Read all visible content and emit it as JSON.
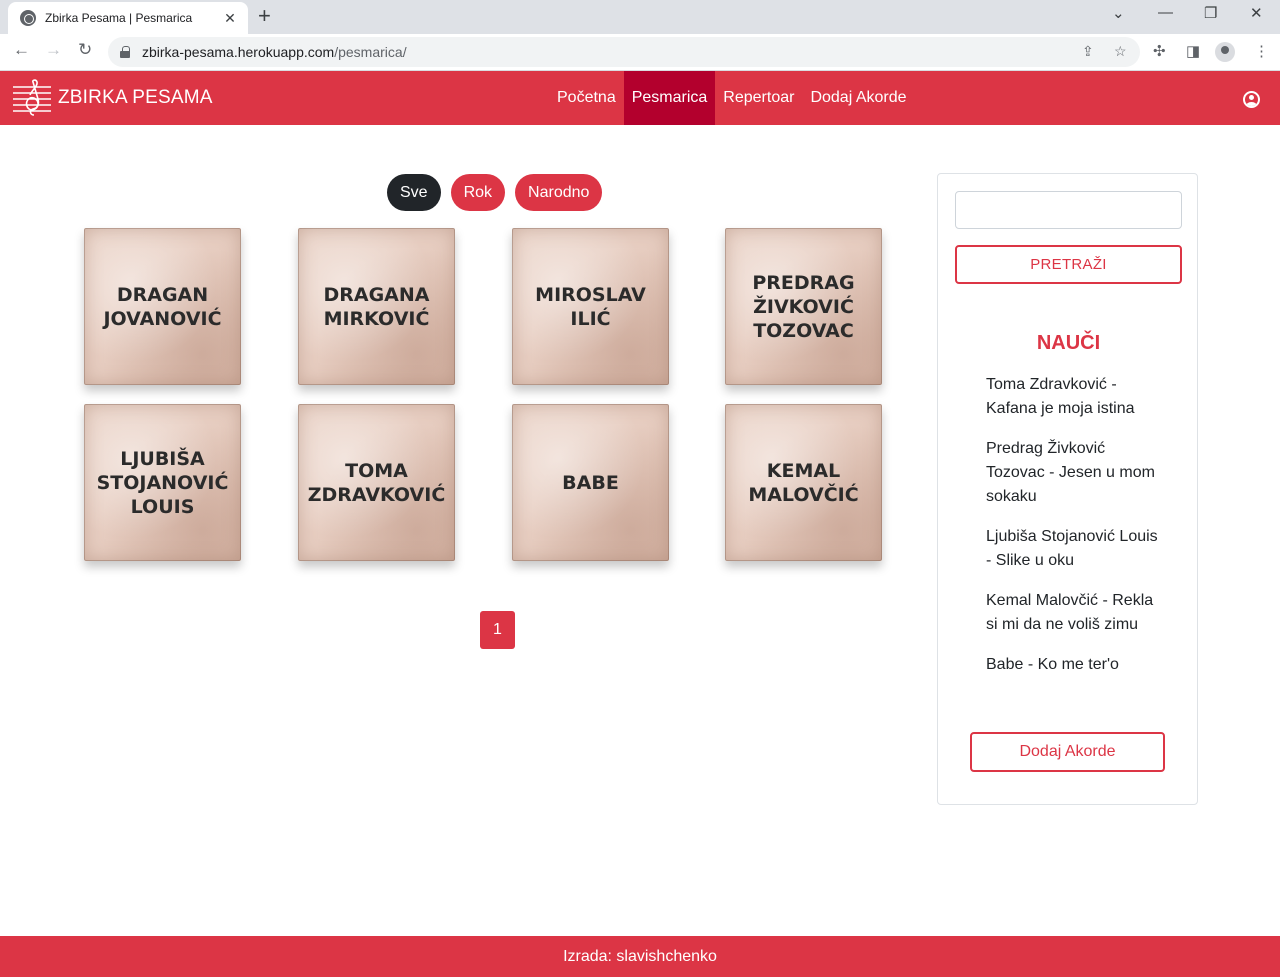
{
  "browser": {
    "tab_title": "Zbirka Pesama | Pesmarica",
    "url_host": "zbirka-pesama.herokuapp.com",
    "url_path": "/pesmarica/"
  },
  "navbar": {
    "brand": "ZBIRKA PESAMA",
    "links": [
      {
        "label": "Početna",
        "active": false
      },
      {
        "label": "Pesmarica",
        "active": true
      },
      {
        "label": "Repertoar",
        "active": false
      },
      {
        "label": "Dodaj Akorde",
        "active": false
      }
    ],
    "colors": {
      "bar": "#dc3545",
      "active": "#b3002d"
    }
  },
  "filters": [
    {
      "label": "Sve",
      "selected": true
    },
    {
      "label": "Rok",
      "selected": false
    },
    {
      "label": "Narodno",
      "selected": false
    }
  ],
  "artists": [
    "DRAGAN JOVANOVIĆ",
    "DRAGANA MIRKOVIĆ",
    "MIROSLAV ILIĆ",
    "PREDRAG ŽIVKOVIĆ TOZOVAC",
    "LJUBIŠA STOJANOVIĆ LOUIS",
    "TOMA ZDRAVKOVIĆ",
    "BABE",
    "KEMAL MALOVČIĆ"
  ],
  "pagination": {
    "current": "1"
  },
  "sidebar": {
    "search_value": "",
    "search_button": "PRETRAŽI",
    "learn_title": "NAUČI",
    "learn_items": [
      "Toma Zdravković - Kafana je moja istina",
      "Predrag Živković Tozovac - Jesen u mom sokaku",
      "Ljubiša Stojanović Louis - Slike u oku",
      "Kemal Malovčić - Rekla si mi da ne voliš zimu",
      "Babe - Ko me ter'o"
    ],
    "add_chords_button": "Dodaj Akorde"
  },
  "footer": {
    "text": "Izrada: slavishchenko"
  }
}
